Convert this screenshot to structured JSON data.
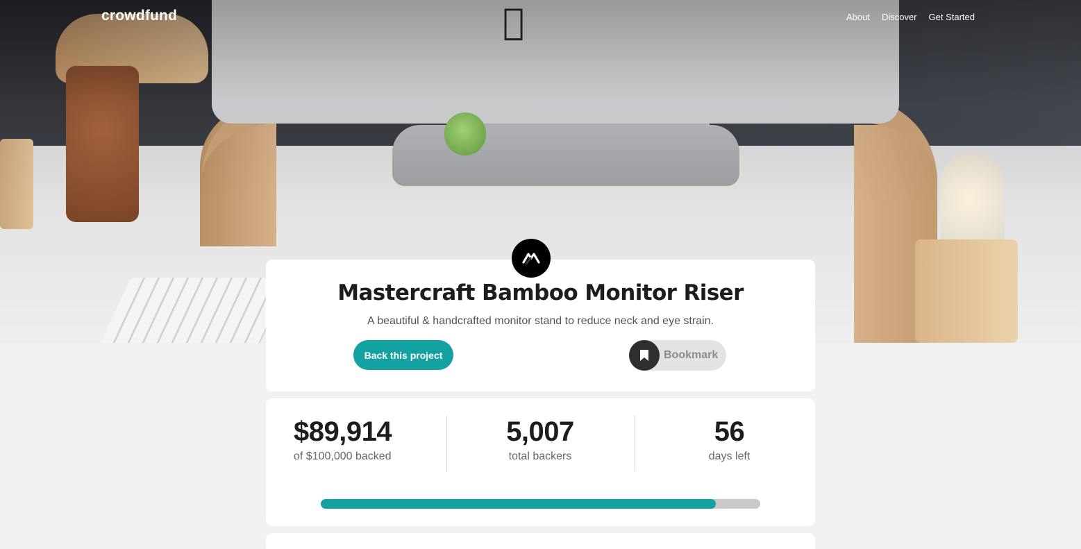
{
  "brand": {
    "logo_text": "crowdfund"
  },
  "nav": {
    "items": [
      {
        "label": "About"
      },
      {
        "label": "Discover"
      },
      {
        "label": "Get Started"
      }
    ]
  },
  "project": {
    "title": "Mastercraft Bamboo Monitor Riser",
    "description": "A beautiful & handcrafted monitor stand to reduce neck and eye strain.",
    "back_button_label": "Back this project",
    "bookmark_label": "Bookmark",
    "logo_icon": "mastercraft-logo-icon",
    "bookmark_icon": "bookmark-icon"
  },
  "stats": {
    "backed": {
      "value": "$89,914",
      "label": "of $100,000 backed"
    },
    "backers": {
      "value": "5,007",
      "label": "total backers"
    },
    "days": {
      "value": "56",
      "label": "days left"
    },
    "progress_fraction": 0.899
  },
  "colors": {
    "accent": "#14a1a1",
    "dark": "#2f2f2f",
    "bookmark_bg": "#e3e3e3"
  }
}
